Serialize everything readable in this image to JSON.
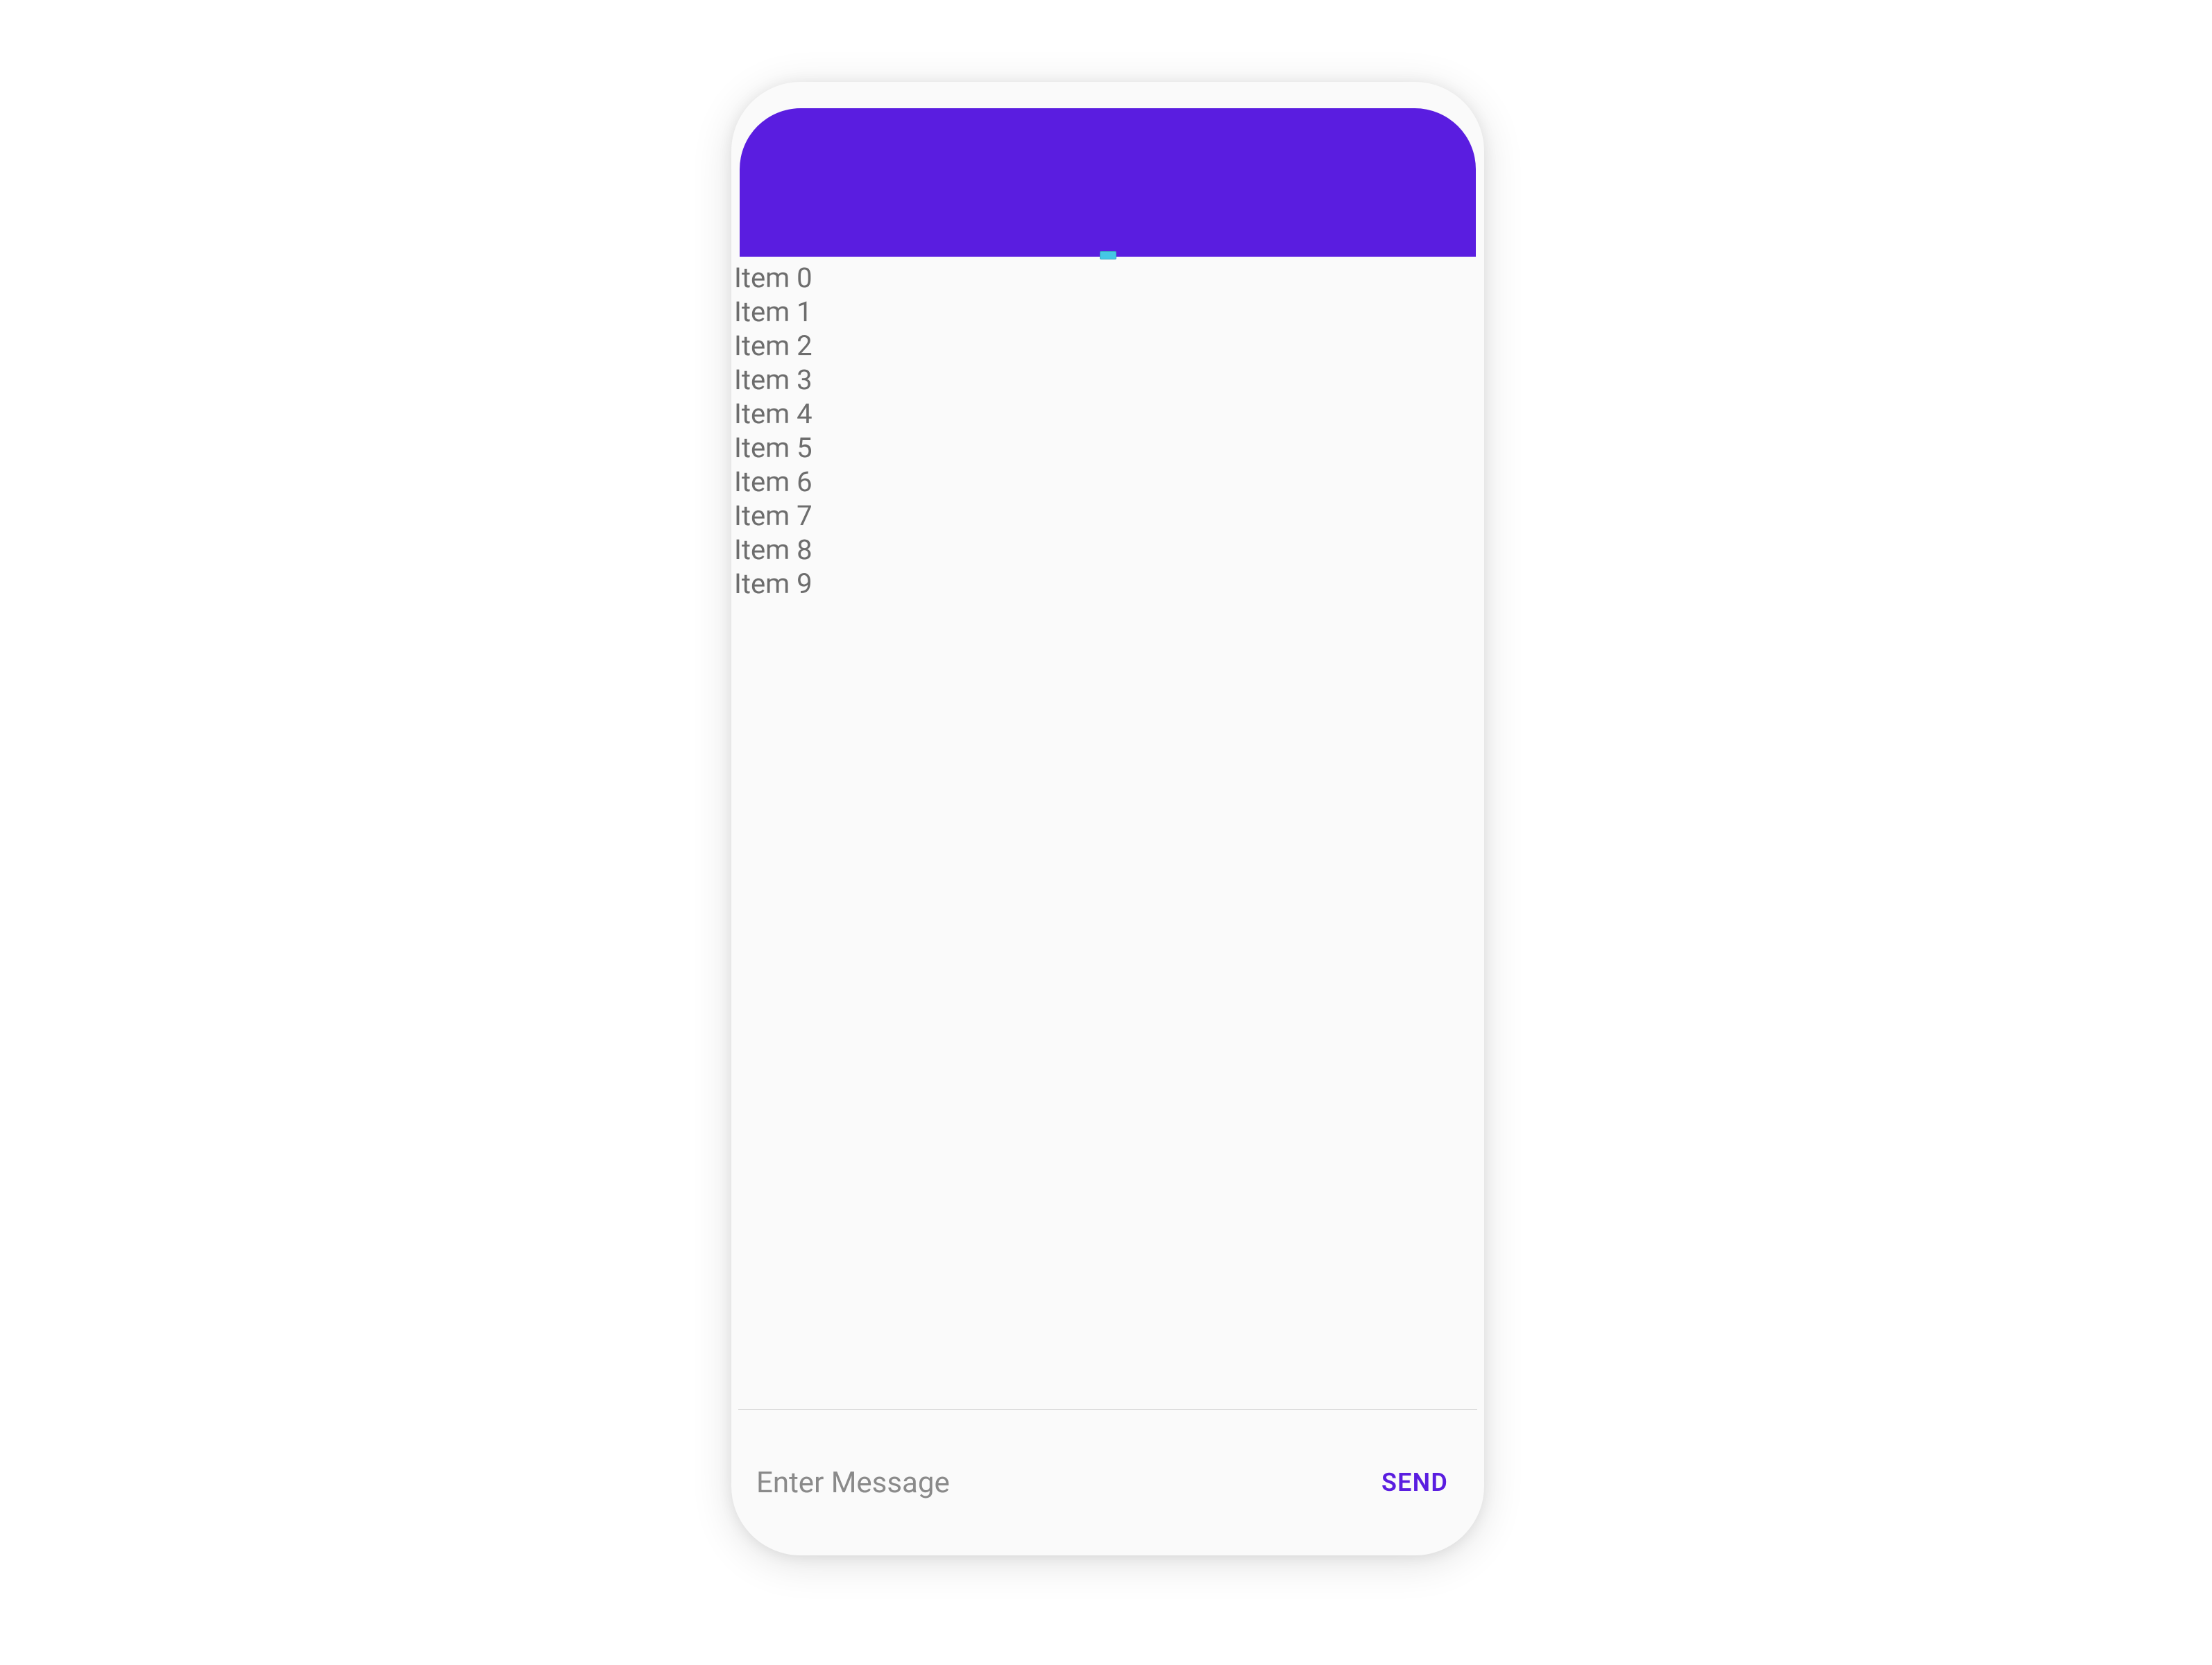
{
  "colors": {
    "accent": "#5a1de0",
    "handle": "#44c7e5"
  },
  "list": {
    "items": [
      {
        "label": "Item 0"
      },
      {
        "label": "Item 1"
      },
      {
        "label": "Item 2"
      },
      {
        "label": "Item 3"
      },
      {
        "label": "Item 4"
      },
      {
        "label": "Item 5"
      },
      {
        "label": "Item 6"
      },
      {
        "label": "Item 7"
      },
      {
        "label": "Item 8"
      },
      {
        "label": "Item 9"
      }
    ]
  },
  "composer": {
    "placeholder": "Enter Message",
    "send_label": "SEND"
  }
}
